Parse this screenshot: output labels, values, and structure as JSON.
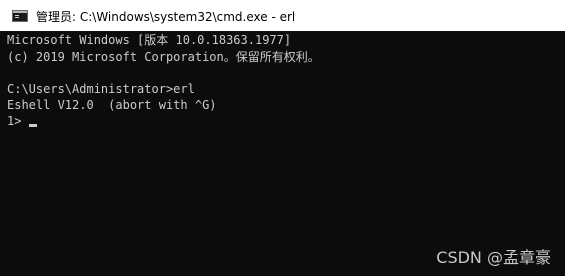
{
  "window": {
    "title": "管理员: C:\\Windows\\system32\\cmd.exe - erl",
    "icon": "console-icon"
  },
  "console": {
    "lines": [
      "Microsoft Windows [版本 10.0.18363.1977]",
      "(c) 2019 Microsoft Corporation。保留所有权利。",
      "C:\\Users\\Administrator>erl",
      "Eshell V12.0  (abort with ^G)",
      "1> "
    ],
    "text_color": "#cccccc",
    "background": "#0c0c0c"
  },
  "watermark": {
    "text": "CSDN @孟章豪"
  }
}
